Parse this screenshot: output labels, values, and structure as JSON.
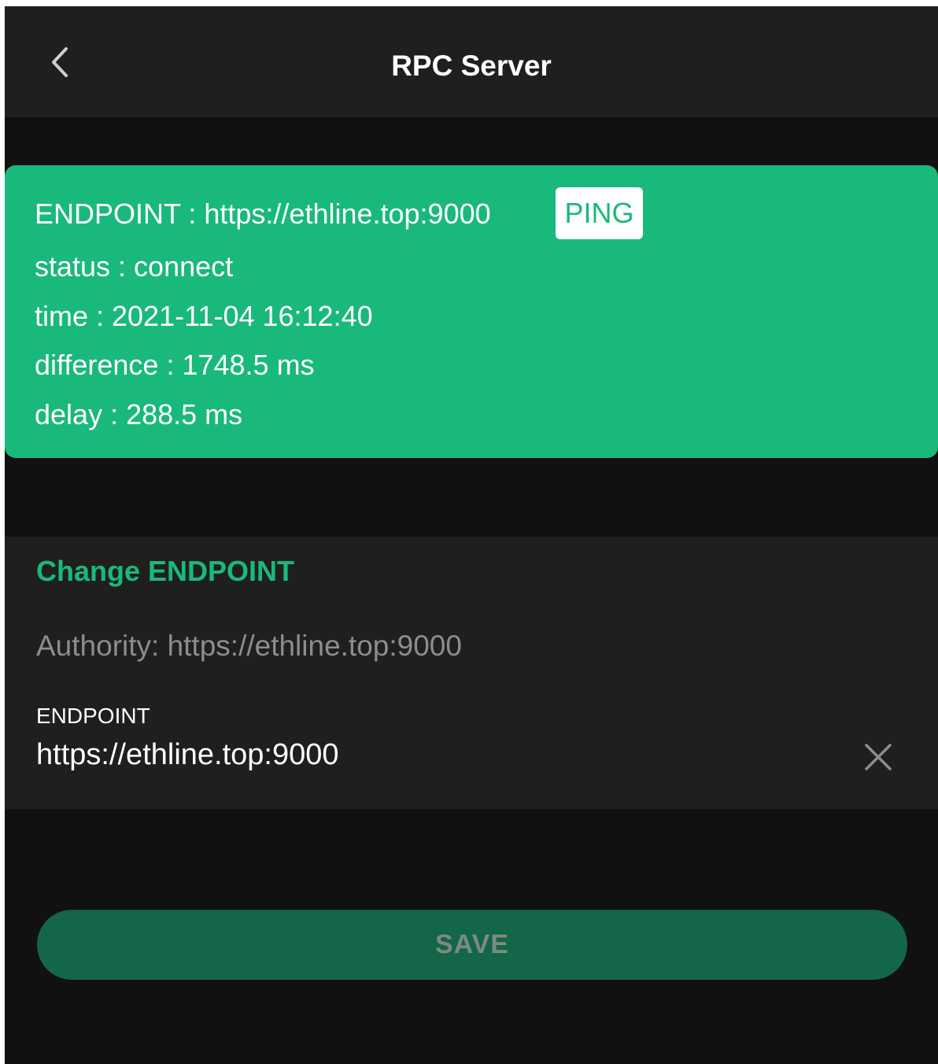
{
  "header": {
    "title": "RPC Server",
    "back_icon": "chevron-left-icon"
  },
  "status": {
    "endpoint_line": "ENDPOINT : https://ethline.top:9000",
    "ping_label": "PING",
    "status_line": "status : connect",
    "time_line": "time : 2021-11-04 16:12:40",
    "difference_line": "difference : 1748.5 ms",
    "delay_line": "delay : 288.5 ms"
  },
  "change": {
    "title": "Change ENDPOINT",
    "authority": "Authority: https://ethline.top:9000",
    "field_label": "ENDPOINT",
    "field_value": "https://ethline.top:9000",
    "clear_icon": "close-icon"
  },
  "footer": {
    "save_label": "SAVE"
  },
  "colors": {
    "accent": "#19b97b",
    "background": "#111111",
    "surface": "#1f1f1f",
    "save_button": "#136647",
    "muted_text": "#8d8d8d"
  }
}
